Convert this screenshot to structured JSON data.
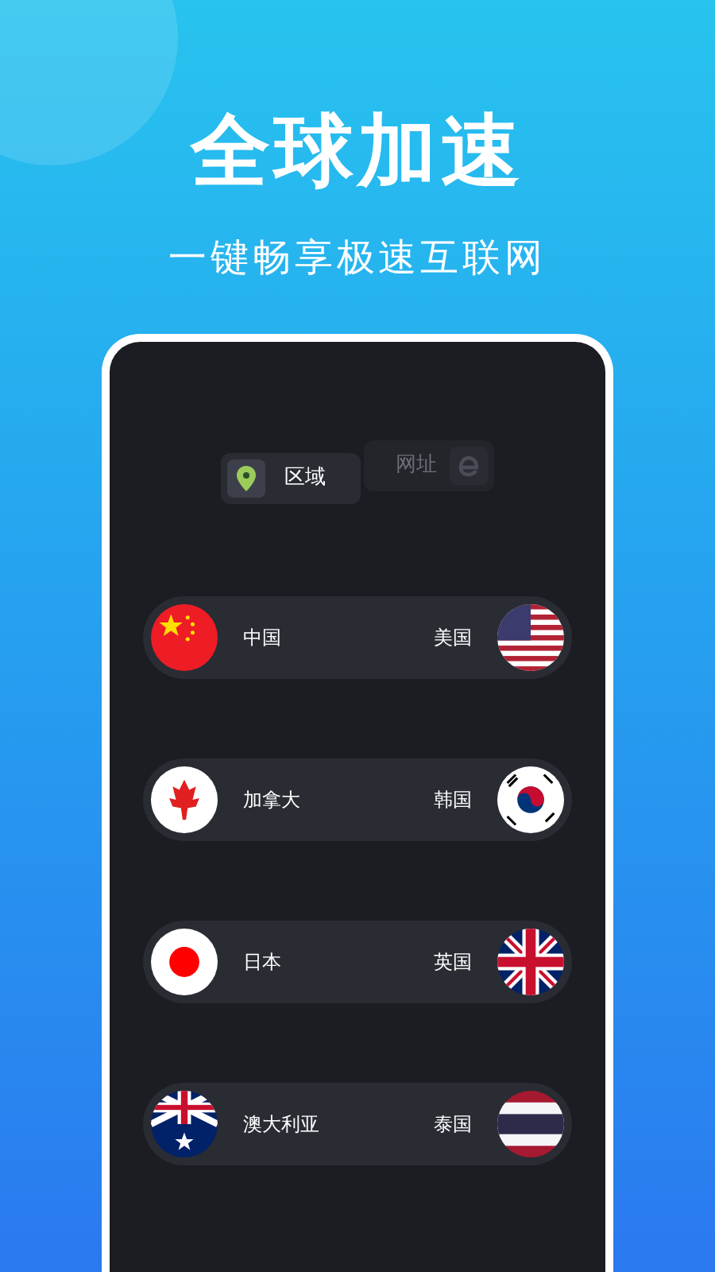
{
  "headline": "全球加速",
  "subtitle": "一键畅享极速互联网",
  "tabs": [
    {
      "label": "区域",
      "selected": true
    },
    {
      "label": "网址",
      "selected": false
    }
  ],
  "routes": [
    {
      "from": "中国",
      "to": "美国"
    },
    {
      "from": "加拿大",
      "to": "韩国"
    },
    {
      "from": "日本",
      "to": "英国"
    },
    {
      "from": "澳大利亚",
      "to": "泰国"
    }
  ]
}
